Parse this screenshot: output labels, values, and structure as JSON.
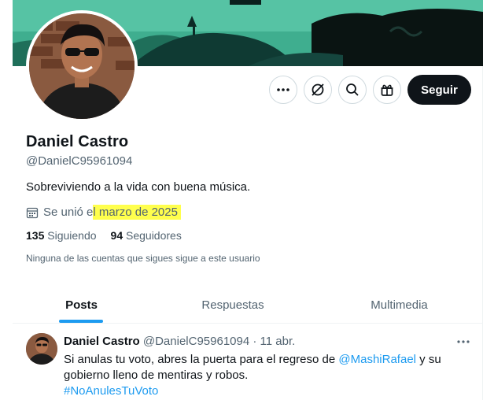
{
  "profile": {
    "name": "Daniel Castro",
    "handle": "@DanielC95961094",
    "bio": "Sobreviviendo a la vida con buena música.",
    "joined_prefix": "Se unió e",
    "joined_highlight": "l marzo de 2025",
    "following_count": "135",
    "following_label": "Siguiendo",
    "followers_count": "94",
    "followers_label": "Seguidores",
    "mutuals_notice": "Ninguna de las cuentas que sigues sigue a este usuario"
  },
  "actions": {
    "follow_label": "Seguir",
    "icons": [
      "more-icon",
      "grok-icon",
      "search-icon",
      "gift-icon"
    ]
  },
  "tabs": [
    {
      "label": "Posts",
      "active": true
    },
    {
      "label": "Respuestas",
      "active": false
    },
    {
      "label": "Multimedia",
      "active": false
    }
  ],
  "tweet": {
    "author": "Daniel Castro",
    "handle": "@DanielC95961094",
    "separator": "·",
    "date": "11 abr.",
    "text_part1": "Si anulas tu voto, abres la puerta para el regreso de ",
    "mention": "@MashiRafael",
    "text_part2": " y su gobierno lleno de mentiras y robos.",
    "hashtag": "#NoAnulesTuVoto"
  },
  "colors": {
    "accent": "#1d9bf0",
    "highlight": "#ffff4d",
    "text_primary": "#0f1419",
    "text_secondary": "#536471",
    "banner_teal": "#3fae8f"
  }
}
